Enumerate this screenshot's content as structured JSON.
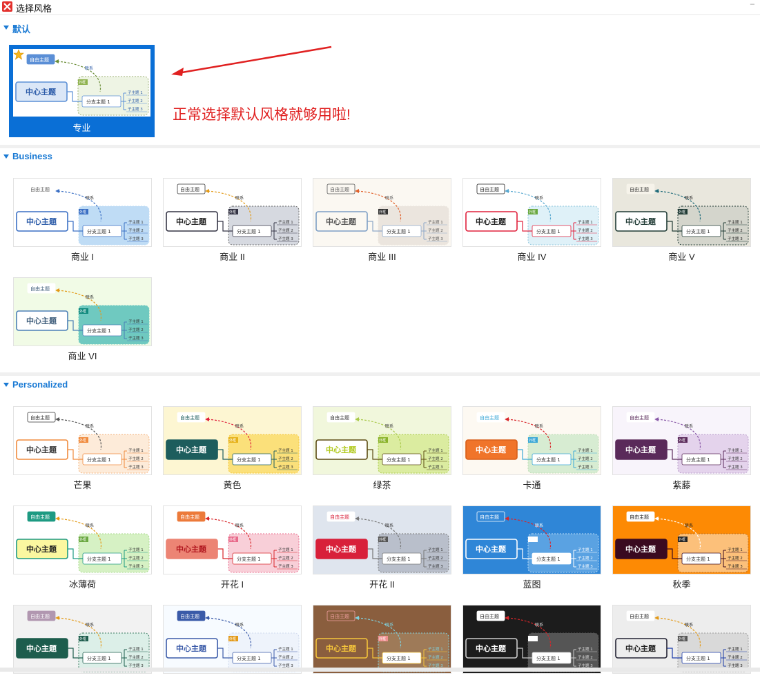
{
  "window": {
    "title": "选择风格"
  },
  "annotation": "正常选择默认风格就够用啦!",
  "sections": [
    {
      "label": "默认",
      "tiles": [
        {
          "label": "专业",
          "selected": true,
          "bg": "#ffffff"
        }
      ]
    },
    {
      "label": "Business",
      "tiles": [
        {
          "label": "商业 I",
          "bg": "#ffffff"
        },
        {
          "label": "商业 II",
          "bg": "#ffffff"
        },
        {
          "label": "商业 III",
          "bg": "#fbf8f2"
        },
        {
          "label": "商业 IV",
          "bg": "#ffffff"
        },
        {
          "label": "商业 V",
          "bg": "#e9e7dd"
        },
        {
          "label": "商业 VI",
          "bg": "#f1fbe6"
        }
      ]
    },
    {
      "label": "Personalized",
      "tiles": [
        {
          "label": "芒果",
          "bg": "#ffffff"
        },
        {
          "label": "黄色",
          "bg": "#fdf6d2"
        },
        {
          "label": "绿茶",
          "bg": "#f1f7dc"
        },
        {
          "label": "卡通",
          "bg": "#fdf9f2"
        },
        {
          "label": "紫藤",
          "bg": "#f8f4fb"
        },
        {
          "label": "冰薄荷",
          "bg": "#ffffff"
        },
        {
          "label": "开花 I",
          "bg": "#ffffff"
        },
        {
          "label": "开花 II",
          "bg": "#dfe5ee"
        },
        {
          "label": "蓝图",
          "bg": "#2f86d7"
        },
        {
          "label": "秋季",
          "bg": "#fd8a04"
        },
        {
          "label": "",
          "bg": "#f2f2f2"
        },
        {
          "label": "",
          "bg": "#f7fbff"
        },
        {
          "label": "",
          "bg": "#8a5e3e"
        },
        {
          "label": "",
          "bg": "#1c1c1c"
        },
        {
          "label": "",
          "bg": "#ededed"
        }
      ]
    }
  ],
  "thumb_text": {
    "center": "中心主题",
    "branch": "分支主题 1",
    "float": "自由主题",
    "relation": "联系",
    "boundary": "外框",
    "sub": [
      "子主题 1",
      "子主题 2",
      "子主题 3"
    ]
  },
  "thumb_styles": [
    {
      "center_fill": "#dbe7f7",
      "center_stroke": "#5b8fd6",
      "center_text": "#2a5aa8",
      "float_fill": "#5b8fd6",
      "float_text": "#ffffff",
      "line": "#5b8fd6",
      "region": "#eef4e4",
      "region_stroke": "#9fb277",
      "rel": "#6d8f3a",
      "tag": "#8fb24f",
      "text": "#2a5aa8"
    },
    {
      "center_fill": "#ffffff",
      "center_stroke": "#3a6fc4",
      "center_text": "#2a5aa8",
      "float_fill": "#ffffff",
      "float_text": "#555555",
      "line": "#3a6fc4",
      "region": "#bfdcf5",
      "region_stroke": "#bfdcf5",
      "rel": "#3a6fc4",
      "tag": "#3a6fc4",
      "text": "#333333"
    },
    {
      "center_fill": "none",
      "center_stroke": "#333344",
      "center_text": "#222222",
      "float_fill": "none",
      "float_text": "#333333",
      "line": "#333344",
      "region": "#d6d9e0",
      "region_stroke": "#666666",
      "rel": "#e39a18",
      "tag": "#334",
      "text": "#333333"
    },
    {
      "center_fill": "none",
      "center_stroke": "#7c9ec5",
      "center_text": "#555555",
      "float_fill": "none",
      "float_text": "#555555",
      "line": "#8ea8c8",
      "region": "#ebe5de",
      "region_stroke": "#ebe5de",
      "rel": "#e0602a",
      "tag": "#333",
      "text": "#555555"
    },
    {
      "center_fill": "none",
      "center_stroke": "#e0203c",
      "center_text": "#222222",
      "float_fill": "none",
      "float_text": "#222222",
      "line": "#e0203c",
      "region": "#dff1f8",
      "region_stroke": "#8fc6dc",
      "rel": "#58a8d0",
      "tag": "#6aa840",
      "text": "#333333"
    },
    {
      "center_fill": "#ffffff",
      "center_stroke": "#1f3a34",
      "center_text": "#1f3a34",
      "float_fill": "#f6f3ea",
      "float_text": "#333333",
      "line": "#1f3a34",
      "region": "#d4d5cc",
      "region_stroke": "#1f3a34",
      "rel": "#1f6b7a",
      "tag": "#1f3a34",
      "text": "#222222"
    },
    {
      "center_fill": "#ffffff",
      "center_stroke": "#4a7fb5",
      "center_text": "#3d5c7a",
      "float_fill": "#ffffff",
      "float_text": "#3d5c7a",
      "line": "#4a7fb5",
      "region": "#6fc9c0",
      "region_stroke": "#6fc9c0",
      "rel": "#e39a18",
      "tag": "#118a7e",
      "text": "#333333"
    },
    {
      "center_fill": "#ffffff",
      "center_stroke": "#f08a3c",
      "center_text": "#333333",
      "float_fill": "none",
      "float_text": "#333333",
      "line": "#f08a3c",
      "region": "#fdebd9",
      "region_stroke": "#f3b27a",
      "rel": "#555555",
      "tag": "#f08a3c",
      "text": "#333333"
    },
    {
      "center_fill": "#1d5d5d",
      "center_stroke": "#1d5d5d",
      "center_text": "#ffffff",
      "float_fill": "#ffffff",
      "float_text": "#1d5d5d",
      "line": "#1d5d5d",
      "region": "#fbe07a",
      "region_stroke": "#f5c53b",
      "rel": "#e0203c",
      "tag": "#e6b21a",
      "text": "#333333"
    },
    {
      "center_fill": "#ffffff",
      "center_stroke": "#5a4a10",
      "center_text": "#b0c81a",
      "float_fill": "#ffffff",
      "float_text": "#333333",
      "line": "#5a4a10",
      "region": "#dbeca0",
      "region_stroke": "#a9c94a",
      "rel": "#a9c94a",
      "tag": "#8ab32a",
      "text": "#333333"
    },
    {
      "center_fill": "#f0742a",
      "center_stroke": "#d85f1a",
      "center_text": "#ffffff",
      "float_fill": "#ffffff",
      "float_text": "#3aa7d6",
      "line": "#3aa7d6",
      "region": "#d7ecd2",
      "region_stroke": "#bcdcb4",
      "rel": "#d8262a",
      "tag": "#3aa7d6",
      "text": "#333333"
    },
    {
      "center_fill": "#5a2a5a",
      "center_stroke": "#5a2a5a",
      "center_text": "#ffffff",
      "float_fill": "#ffffff",
      "float_text": "#5a2a5a",
      "line": "#5a2a5a",
      "region": "#e4d3ec",
      "region_stroke": "#b79bc8",
      "rel": "#8a5aa8",
      "tag": "#5a2a5a",
      "text": "#333333"
    },
    {
      "center_fill": "#fbf7a0",
      "center_stroke": "#1d9a82",
      "center_text": "#222222",
      "float_fill": "#1d9a82",
      "float_text": "#ffffff",
      "line": "#1d9a82",
      "region": "#d6f1c4",
      "region_stroke": "#a6d98a",
      "rel": "#e39a18",
      "tag": "#6aa840",
      "text": "#333333"
    },
    {
      "center_fill": "#ec8474",
      "center_stroke": "#ec8474",
      "center_text": "#b0161e",
      "float_fill": "#ec7a3a",
      "float_text": "#ffffff",
      "line": "#d8262a",
      "region": "#f8cfd8",
      "region_stroke": "#e86a8a",
      "rel": "#d8262a",
      "tag": "#e86a8a",
      "text": "#333333"
    },
    {
      "center_fill": "#d8203a",
      "center_stroke": "#d8203a",
      "center_text": "#ffffff",
      "float_fill": "#ffffff",
      "float_text": "#d8203a",
      "line": "#777777",
      "region": "#b9bfcb",
      "region_stroke": "#777777",
      "rel": "#777777",
      "tag": "#555",
      "text": "#333333"
    },
    {
      "center_fill": "none",
      "center_stroke": "#ffffff",
      "center_text": "#ffffff",
      "float_fill": "none",
      "float_text": "#ffffff",
      "line": "#ffffff",
      "region": "#5aa2e2",
      "region_stroke": "#bcdcf5",
      "rel": "#d8262a",
      "tag": "#ffffff",
      "text": "#ffffff"
    },
    {
      "center_fill": "#3a0a20",
      "center_stroke": "#3a0a20",
      "center_text": "#ffffff",
      "float_fill": "#ffffff",
      "float_text": "#222222",
      "line": "#3a0a20",
      "region": "#fcc07a",
      "region_stroke": "#c07020",
      "rel": "#ffffff",
      "tag": "#222",
      "text": "#222222"
    },
    {
      "center_fill": "#1d5d4d",
      "center_stroke": "#1d5d4d",
      "center_text": "#ffffff",
      "float_fill": "#b197b0",
      "float_text": "#ffffff",
      "line": "#1d5d4d",
      "region": "#dcefe8",
      "region_stroke": "#3a7a60",
      "rel": "#e39a18",
      "tag": "#1d5d4d",
      "text": "#333333"
    },
    {
      "center_fill": "#ffffff",
      "center_stroke": "#3a5aa8",
      "center_text": "#3a5aa8",
      "float_fill": "#3a5aa8",
      "float_text": "#ffffff",
      "line": "#3a5aa8",
      "region": "#eef3fb",
      "region_stroke": "#cfd9ee",
      "rel": "#3a5aa8",
      "tag": "#e39a18",
      "text": "#333333"
    },
    {
      "center_fill": "none",
      "center_stroke": "#f5c53b",
      "center_text": "#f5c53b",
      "float_fill": "none",
      "float_text": "#f0a0a0",
      "line": "#f5c53b",
      "region": "#9e7a58",
      "region_stroke": "#7fd3e0",
      "rel": "#7fd3e0",
      "tag": "#f09090",
      "text": "#7fd3e0"
    },
    {
      "center_fill": "none",
      "center_stroke": "#cccccc",
      "center_text": "#ffffff",
      "float_fill": "#ffffff",
      "float_text": "#222222",
      "line": "#cccccc",
      "region": "#555555",
      "region_stroke": "#555555",
      "rel": "#d8262a",
      "tag": "#ffffff",
      "text": "#dddddd"
    },
    {
      "center_fill": "none",
      "center_stroke": "#222233",
      "center_text": "#222222",
      "float_fill": "#ffffff",
      "float_text": "#222222",
      "line": "#1a3aa8",
      "region": "#d9d9d9",
      "region_stroke": "#999999",
      "rel": "#e39a18",
      "tag": "#555",
      "text": "#222222"
    }
  ]
}
